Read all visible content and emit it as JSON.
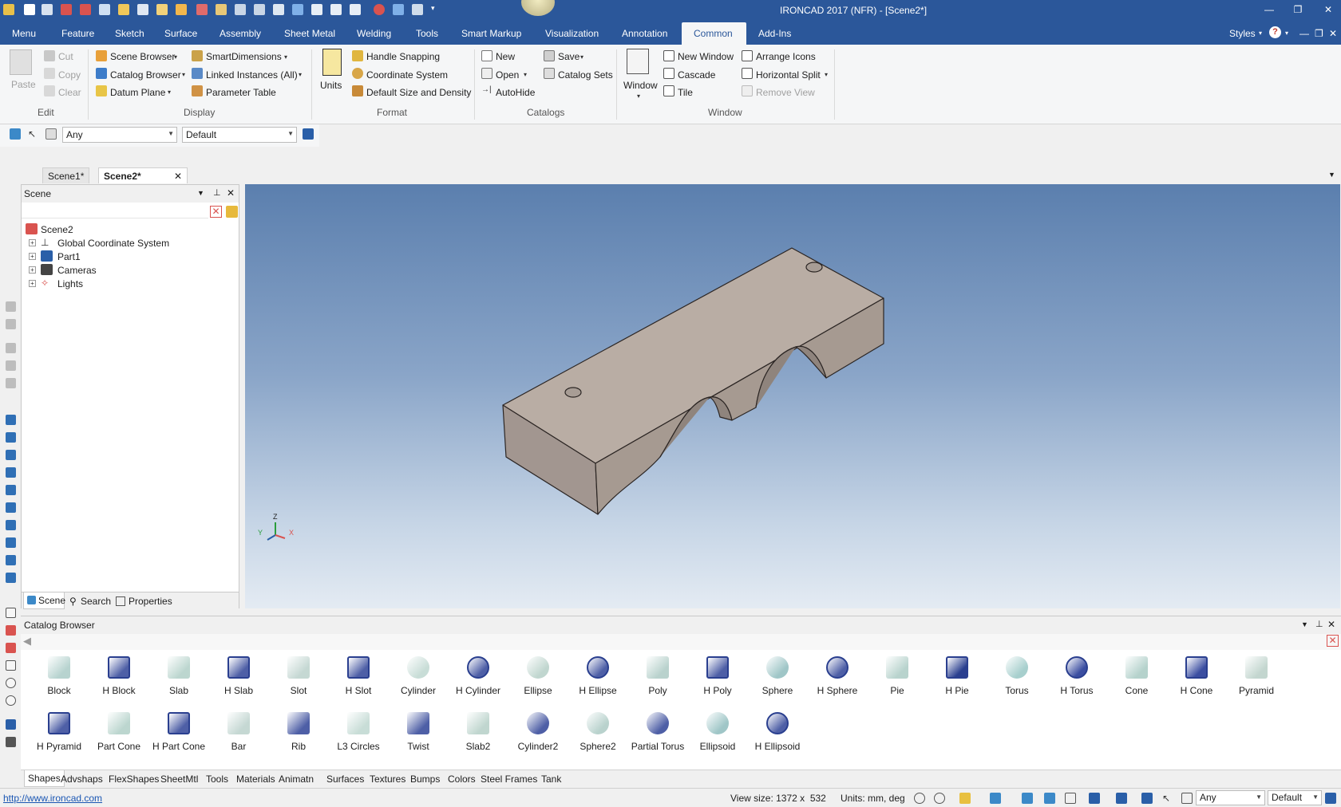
{
  "title": "IRONCAD 2017 (NFR) - [Scene2*]",
  "menu_tabs": [
    "Menu",
    "Feature",
    "Sketch",
    "Surface",
    "Assembly",
    "Sheet Metal",
    "Welding",
    "Tools",
    "Smart Markup",
    "Visualization",
    "Annotation",
    "Common",
    "Add-Ins"
  ],
  "active_tab": "Common",
  "styles_label": "Styles",
  "ribbon": {
    "edit": {
      "cut": "Cut",
      "copy": "Copy",
      "clear": "Clear",
      "paste": "Paste",
      "group": "Edit"
    },
    "display": {
      "scene_browser": "Scene Browser",
      "catalog_browser": "Catalog Browser",
      "datum_plane": "Datum Plane",
      "smart_dimensions": "SmartDimensions",
      "linked_instances": "Linked Instances (All)",
      "parameter_table": "Parameter Table",
      "group": "Display"
    },
    "format": {
      "units": "Units",
      "handle_snapping": "Handle Snapping",
      "coordinate_system": "Coordinate System",
      "default_size": "Default Size and Density",
      "group": "Format"
    },
    "catalogs": {
      "new": "New",
      "open": "Open",
      "autohide": "AutoHide",
      "save": "Save",
      "catalog_sets": "Catalog Sets",
      "group": "Catalogs"
    },
    "window": {
      "window": "Window",
      "new_window": "New Window",
      "cascade": "Cascade",
      "tile": "Tile",
      "arrange_icons": "Arrange Icons",
      "horizontal_split": "Horizontal Split",
      "remove_view": "Remove View",
      "group": "Window"
    }
  },
  "selection_bar": {
    "filter": "Any",
    "config": "Default"
  },
  "doc_tabs": [
    "Scene1*",
    "Scene2*"
  ],
  "scene_panel": {
    "title": "Scene",
    "tree": [
      "Scene2",
      "Global Coordinate System",
      "Part1",
      "Cameras",
      "Lights"
    ],
    "tabs": [
      "Scene",
      "Search",
      "Properties"
    ]
  },
  "viewport": {
    "axis_labels": {
      "z": "Z",
      "y": "Y",
      "x": "X"
    }
  },
  "catalog": {
    "title": "Catalog Browser",
    "items_row1": [
      "Block",
      "H Block",
      "Slab",
      "H Slab",
      "Slot",
      "H Slot",
      "Cylinder",
      "H Cylinder",
      "Ellipse",
      "H Ellipse",
      "Poly",
      "H Poly",
      "Sphere",
      "H Sphere",
      "Pie",
      "H Pie",
      "Torus",
      "H Torus",
      "Cone",
      "H Cone",
      "Pyramid"
    ],
    "items_row2": [
      "H Pyramid",
      "Part Cone",
      "H Part Cone",
      "Bar",
      "Rib",
      "L3 Circles",
      "Twist",
      "Slab2",
      "Cylinder2",
      "Sphere2",
      "Partial Torus",
      "Ellipsoid",
      "H Ellipsoid"
    ],
    "tabs": [
      "Shapes",
      "Advshaps",
      "FlexShapes",
      "SheetMtl",
      "Tools",
      "Materials",
      "Animatn",
      "Surfaces",
      "Textures",
      "Bumps",
      "Colors",
      "Steel Frames",
      "Tank"
    ],
    "active_tab": "Shapes"
  },
  "status": {
    "url": "http://www.ironcad.com",
    "view_size": "View size: 1372 x  532",
    "units": "Units: mm, deg",
    "filter": "Any",
    "config": "Default"
  },
  "colors": {
    "title_blue": "#2b579a",
    "part_top": "#b9ada4",
    "part_front": "#9d9088",
    "part_side": "#a69a91"
  }
}
